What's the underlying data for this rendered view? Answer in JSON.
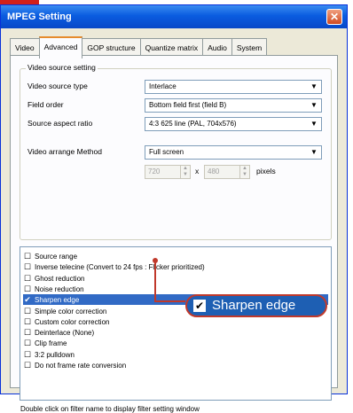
{
  "window": {
    "title": "MPEG Setting",
    "close": "✕"
  },
  "tabs": [
    {
      "label": "Video"
    },
    {
      "label": "Advanced"
    },
    {
      "label": "GOP structure"
    },
    {
      "label": "Quantize matrix"
    },
    {
      "label": "Audio"
    },
    {
      "label": "System"
    }
  ],
  "video_source": {
    "group_title": "Video source setting",
    "type_label": "Video source type",
    "type_value": "Interlace",
    "field_order_label": "Field order",
    "field_order_value": "Bottom field first (field B)",
    "aspect_label": "Source aspect ratio",
    "aspect_value": "4:3 625 line (PAL, 704x576)",
    "arrange_label": "Video arrange Method",
    "arrange_value": "Full screen",
    "width_value": "720",
    "height_value": "480",
    "times_sign": "x",
    "pixels_label": "pixels"
  },
  "filters": [
    {
      "label": "Source range",
      "checked": false
    },
    {
      "label": "Inverse telecine (Convert to 24 fps : Flicker prioritized)",
      "checked": false
    },
    {
      "label": "Ghost reduction",
      "checked": false
    },
    {
      "label": "Noise reduction",
      "checked": false
    },
    {
      "label": "Sharpen edge",
      "checked": true,
      "selected": true
    },
    {
      "label": "Simple color correction",
      "checked": false
    },
    {
      "label": "Custom color correction",
      "checked": false
    },
    {
      "label": "Deinterlace (None)",
      "checked": false
    },
    {
      "label": "Clip frame",
      "checked": false
    },
    {
      "label": "3:2 pulldown",
      "checked": false
    },
    {
      "label": "Do not frame rate conversion",
      "checked": false
    }
  ],
  "hint_text": "Double click on filter name to display filter setting window",
  "callout": {
    "label": "Sharpen edge",
    "check": "✔"
  },
  "colors": {
    "selection": "#316ac5",
    "callout_border": "#c0392b",
    "title_bar": "#0a5ce0"
  }
}
